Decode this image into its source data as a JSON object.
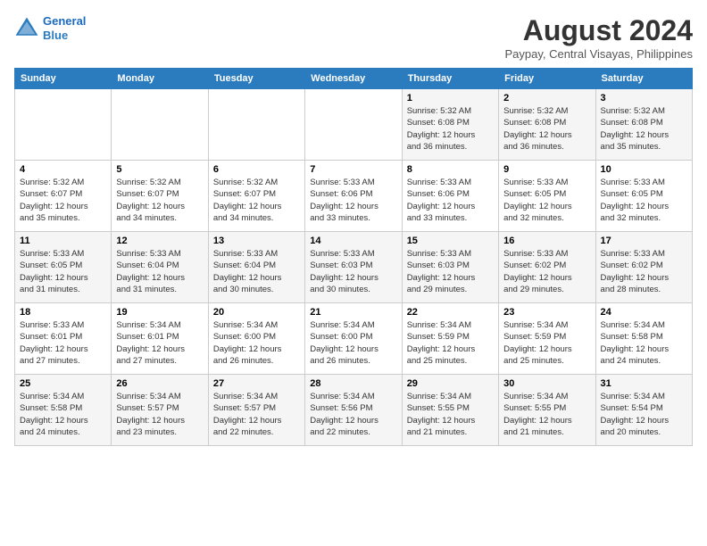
{
  "header": {
    "logo_line1": "General",
    "logo_line2": "Blue",
    "month_title": "August 2024",
    "subtitle": "Paypay, Central Visayas, Philippines"
  },
  "weekdays": [
    "Sunday",
    "Monday",
    "Tuesday",
    "Wednesday",
    "Thursday",
    "Friday",
    "Saturday"
  ],
  "weeks": [
    [
      {
        "day": "",
        "info": ""
      },
      {
        "day": "",
        "info": ""
      },
      {
        "day": "",
        "info": ""
      },
      {
        "day": "",
        "info": ""
      },
      {
        "day": "1",
        "info": "Sunrise: 5:32 AM\nSunset: 6:08 PM\nDaylight: 12 hours\nand 36 minutes."
      },
      {
        "day": "2",
        "info": "Sunrise: 5:32 AM\nSunset: 6:08 PM\nDaylight: 12 hours\nand 36 minutes."
      },
      {
        "day": "3",
        "info": "Sunrise: 5:32 AM\nSunset: 6:08 PM\nDaylight: 12 hours\nand 35 minutes."
      }
    ],
    [
      {
        "day": "4",
        "info": "Sunrise: 5:32 AM\nSunset: 6:07 PM\nDaylight: 12 hours\nand 35 minutes."
      },
      {
        "day": "5",
        "info": "Sunrise: 5:32 AM\nSunset: 6:07 PM\nDaylight: 12 hours\nand 34 minutes."
      },
      {
        "day": "6",
        "info": "Sunrise: 5:32 AM\nSunset: 6:07 PM\nDaylight: 12 hours\nand 34 minutes."
      },
      {
        "day": "7",
        "info": "Sunrise: 5:33 AM\nSunset: 6:06 PM\nDaylight: 12 hours\nand 33 minutes."
      },
      {
        "day": "8",
        "info": "Sunrise: 5:33 AM\nSunset: 6:06 PM\nDaylight: 12 hours\nand 33 minutes."
      },
      {
        "day": "9",
        "info": "Sunrise: 5:33 AM\nSunset: 6:05 PM\nDaylight: 12 hours\nand 32 minutes."
      },
      {
        "day": "10",
        "info": "Sunrise: 5:33 AM\nSunset: 6:05 PM\nDaylight: 12 hours\nand 32 minutes."
      }
    ],
    [
      {
        "day": "11",
        "info": "Sunrise: 5:33 AM\nSunset: 6:05 PM\nDaylight: 12 hours\nand 31 minutes."
      },
      {
        "day": "12",
        "info": "Sunrise: 5:33 AM\nSunset: 6:04 PM\nDaylight: 12 hours\nand 31 minutes."
      },
      {
        "day": "13",
        "info": "Sunrise: 5:33 AM\nSunset: 6:04 PM\nDaylight: 12 hours\nand 30 minutes."
      },
      {
        "day": "14",
        "info": "Sunrise: 5:33 AM\nSunset: 6:03 PM\nDaylight: 12 hours\nand 30 minutes."
      },
      {
        "day": "15",
        "info": "Sunrise: 5:33 AM\nSunset: 6:03 PM\nDaylight: 12 hours\nand 29 minutes."
      },
      {
        "day": "16",
        "info": "Sunrise: 5:33 AM\nSunset: 6:02 PM\nDaylight: 12 hours\nand 29 minutes."
      },
      {
        "day": "17",
        "info": "Sunrise: 5:33 AM\nSunset: 6:02 PM\nDaylight: 12 hours\nand 28 minutes."
      }
    ],
    [
      {
        "day": "18",
        "info": "Sunrise: 5:33 AM\nSunset: 6:01 PM\nDaylight: 12 hours\nand 27 minutes."
      },
      {
        "day": "19",
        "info": "Sunrise: 5:34 AM\nSunset: 6:01 PM\nDaylight: 12 hours\nand 27 minutes."
      },
      {
        "day": "20",
        "info": "Sunrise: 5:34 AM\nSunset: 6:00 PM\nDaylight: 12 hours\nand 26 minutes."
      },
      {
        "day": "21",
        "info": "Sunrise: 5:34 AM\nSunset: 6:00 PM\nDaylight: 12 hours\nand 26 minutes."
      },
      {
        "day": "22",
        "info": "Sunrise: 5:34 AM\nSunset: 5:59 PM\nDaylight: 12 hours\nand 25 minutes."
      },
      {
        "day": "23",
        "info": "Sunrise: 5:34 AM\nSunset: 5:59 PM\nDaylight: 12 hours\nand 25 minutes."
      },
      {
        "day": "24",
        "info": "Sunrise: 5:34 AM\nSunset: 5:58 PM\nDaylight: 12 hours\nand 24 minutes."
      }
    ],
    [
      {
        "day": "25",
        "info": "Sunrise: 5:34 AM\nSunset: 5:58 PM\nDaylight: 12 hours\nand 24 minutes."
      },
      {
        "day": "26",
        "info": "Sunrise: 5:34 AM\nSunset: 5:57 PM\nDaylight: 12 hours\nand 23 minutes."
      },
      {
        "day": "27",
        "info": "Sunrise: 5:34 AM\nSunset: 5:57 PM\nDaylight: 12 hours\nand 22 minutes."
      },
      {
        "day": "28",
        "info": "Sunrise: 5:34 AM\nSunset: 5:56 PM\nDaylight: 12 hours\nand 22 minutes."
      },
      {
        "day": "29",
        "info": "Sunrise: 5:34 AM\nSunset: 5:55 PM\nDaylight: 12 hours\nand 21 minutes."
      },
      {
        "day": "30",
        "info": "Sunrise: 5:34 AM\nSunset: 5:55 PM\nDaylight: 12 hours\nand 21 minutes."
      },
      {
        "day": "31",
        "info": "Sunrise: 5:34 AM\nSunset: 5:54 PM\nDaylight: 12 hours\nand 20 minutes."
      }
    ]
  ]
}
